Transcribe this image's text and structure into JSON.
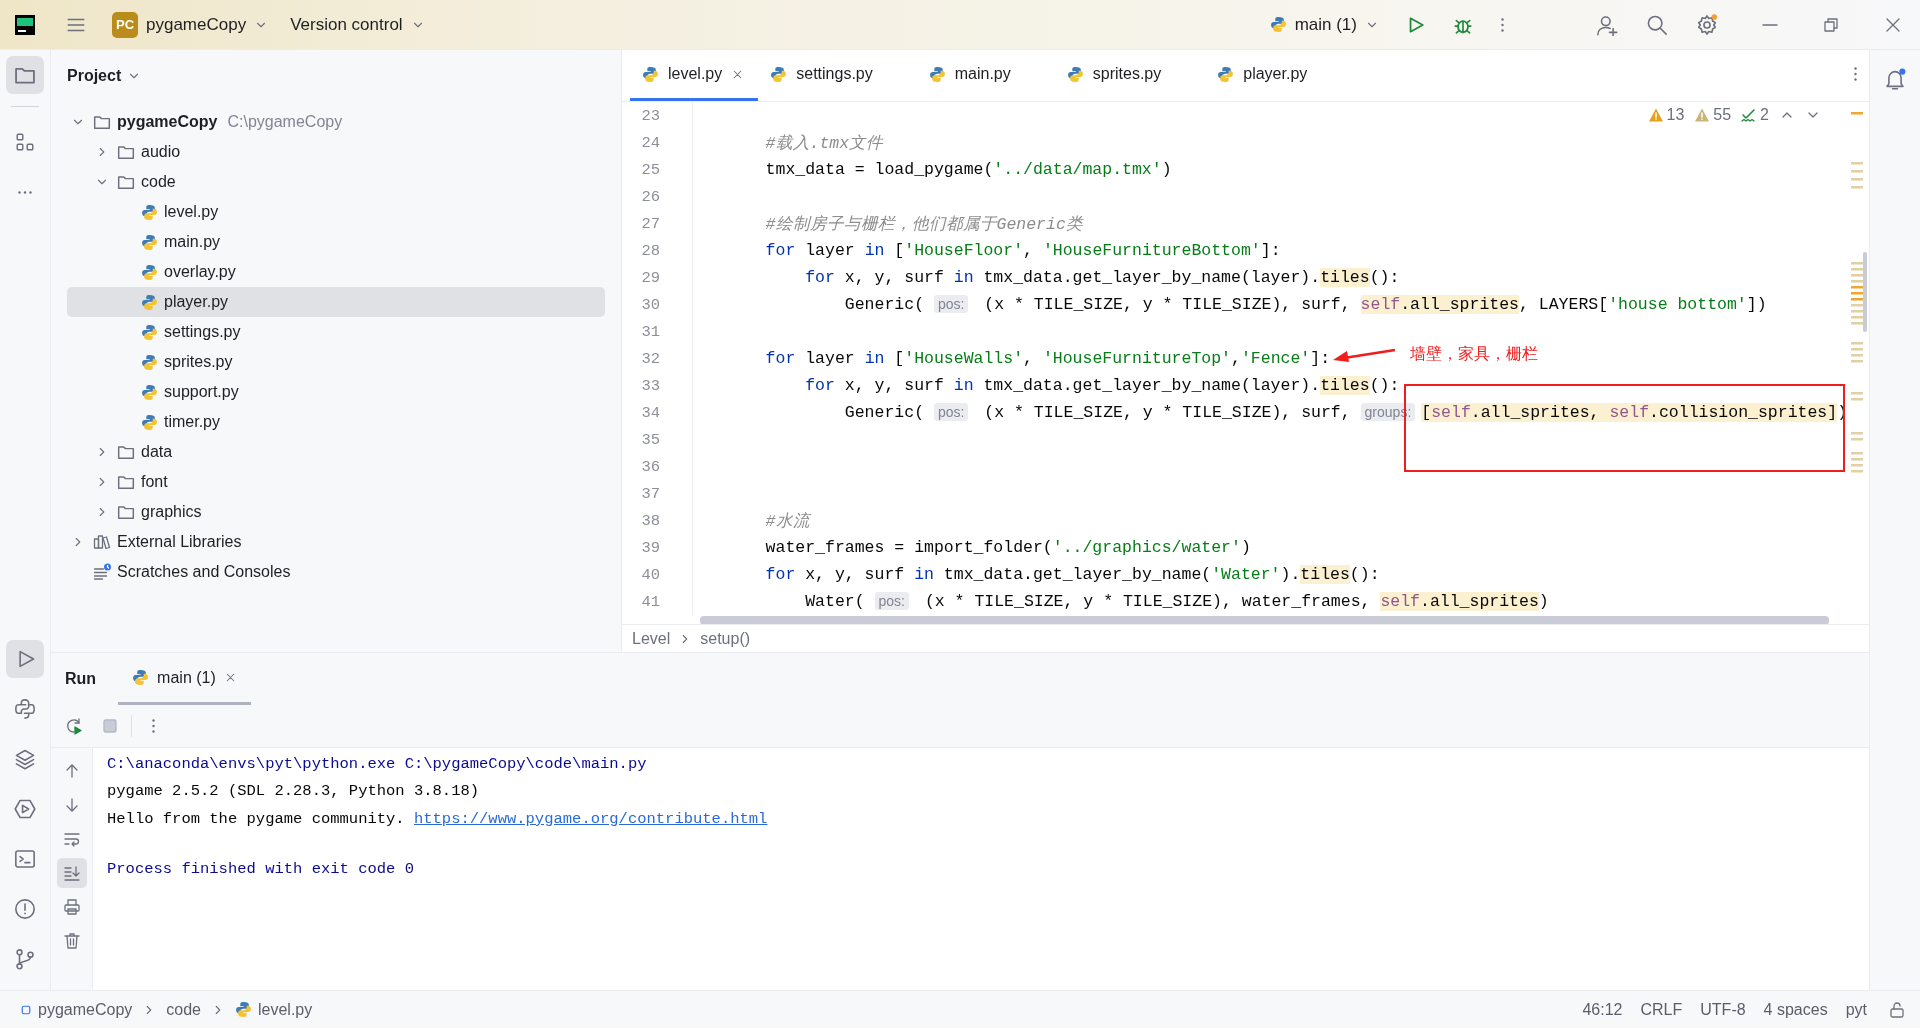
{
  "title_bar": {
    "project_badge": "PC",
    "project": "pygameCopy",
    "vcs": "Version control",
    "run_config": "main (1)"
  },
  "project_panel": {
    "title": "Project",
    "tree": [
      {
        "label": "pygameCopy",
        "path": "C:\\pygameCopy",
        "kind": "folder",
        "expanded": true,
        "selected": false,
        "children": [
          {
            "label": "audio",
            "kind": "folder",
            "expanded": false,
            "selected": false
          },
          {
            "label": "code",
            "kind": "folder",
            "expanded": true,
            "selected": false,
            "children": [
              {
                "label": "level.py",
                "kind": "python",
                "selected": false
              },
              {
                "label": "main.py",
                "kind": "python",
                "selected": false
              },
              {
                "label": "overlay.py",
                "kind": "python",
                "selected": false
              },
              {
                "label": "player.py",
                "kind": "python",
                "selected": true
              },
              {
                "label": "settings.py",
                "kind": "python",
                "selected": false
              },
              {
                "label": "sprites.py",
                "kind": "python",
                "selected": false
              },
              {
                "label": "support.py",
                "kind": "python",
                "selected": false
              },
              {
                "label": "timer.py",
                "kind": "python",
                "selected": false
              }
            ]
          },
          {
            "label": "data",
            "kind": "folder",
            "expanded": false,
            "selected": false
          },
          {
            "label": "font",
            "kind": "folder",
            "expanded": false,
            "selected": false
          },
          {
            "label": "graphics",
            "kind": "folder",
            "expanded": false,
            "selected": false
          }
        ]
      },
      {
        "label": "External Libraries",
        "kind": "library",
        "expanded": false,
        "selected": false
      },
      {
        "label": "Scratches and Consoles",
        "kind": "scratches",
        "selected": false
      }
    ]
  },
  "editor": {
    "tabs": [
      {
        "label": "level.py",
        "selected": true,
        "closable": true
      },
      {
        "label": "settings.py",
        "selected": false,
        "closable": false
      },
      {
        "label": "main.py",
        "selected": false,
        "closable": false
      },
      {
        "label": "sprites.py",
        "selected": false,
        "closable": false
      },
      {
        "label": "player.py",
        "selected": false,
        "closable": false
      }
    ],
    "inspections": [
      {
        "kind": "error",
        "count": "13"
      },
      {
        "kind": "warning",
        "count": "55"
      },
      {
        "kind": "typo",
        "count": "2"
      }
    ],
    "lines": [
      {
        "number": "23"
      },
      {
        "number": "24",
        "tokens": [
          {
            "kind": "comment",
            "text": "    #载入.tmx文件"
          }
        ]
      },
      {
        "number": "25",
        "tokens": [
          {
            "kind": "plain",
            "text": "    tmx_data = load_pygame("
          },
          {
            "kind": "string",
            "text": "'../data/map.tmx'"
          },
          {
            "kind": "plain",
            "text": ")"
          }
        ]
      },
      {
        "number": "26"
      },
      {
        "number": "27",
        "tokens": [
          {
            "kind": "comment",
            "text": "    #绘制房子与栅栏，他们都属于Generic类"
          }
        ]
      },
      {
        "number": "28",
        "tokens": [
          {
            "kind": "keyword",
            "text": "    for"
          },
          {
            "kind": "plain",
            "text": " layer "
          },
          {
            "kind": "keyword",
            "text": "in"
          },
          {
            "kind": "plain",
            "text": " ["
          },
          {
            "kind": "string",
            "text": "'HouseFloor'"
          },
          {
            "kind": "plain",
            "text": ", "
          },
          {
            "kind": "string",
            "text": "'HouseFurnitureBottom'"
          },
          {
            "kind": "plain",
            "text": "]:"
          }
        ]
      },
      {
        "number": "29",
        "tokens": [
          {
            "kind": "keyword",
            "text": "        for"
          },
          {
            "kind": "plain",
            "text": " x, y, surf "
          },
          {
            "kind": "keyword",
            "text": "in"
          },
          {
            "kind": "plain",
            "text": " tmx_data.get_layer_by_name(layer)."
          },
          {
            "kind": "usage",
            "text": "tiles"
          },
          {
            "kind": "plain",
            "text": "():"
          }
        ]
      },
      {
        "number": "30",
        "tokens": [
          {
            "kind": "plain",
            "text": "            Generic( "
          },
          {
            "kind": "inlay",
            "text": "pos:"
          },
          {
            "kind": "plain",
            "text": " (x * TILE_SIZE, y * TILE_SIZE), surf, "
          },
          {
            "kind": "self-usage",
            "text": "self"
          },
          {
            "kind": "usage",
            "text": ".all_sprites"
          },
          {
            "kind": "plain",
            "text": ", LAYERS["
          },
          {
            "kind": "string",
            "text": "'house bottom'"
          },
          {
            "kind": "plain",
            "text": "])"
          }
        ]
      },
      {
        "number": "31"
      },
      {
        "number": "32",
        "tokens": [
          {
            "kind": "keyword",
            "text": "    for"
          },
          {
            "kind": "plain",
            "text": " layer "
          },
          {
            "kind": "keyword",
            "text": "in"
          },
          {
            "kind": "plain",
            "text": " ["
          },
          {
            "kind": "string",
            "text": "'HouseWalls'"
          },
          {
            "kind": "plain",
            "text": ", "
          },
          {
            "kind": "string",
            "text": "'HouseFurnitureTop'"
          },
          {
            "kind": "plain",
            "text": ","
          },
          {
            "kind": "string",
            "text": "'Fence'"
          },
          {
            "kind": "plain",
            "text": "]:"
          }
        ]
      },
      {
        "number": "33",
        "tokens": [
          {
            "kind": "keyword",
            "text": "        for"
          },
          {
            "kind": "plain",
            "text": " x, y, surf "
          },
          {
            "kind": "keyword",
            "text": "in"
          },
          {
            "kind": "plain",
            "text": " tmx_data.get_layer_by_name(layer)."
          },
          {
            "kind": "usage",
            "text": "tiles"
          },
          {
            "kind": "plain",
            "text": "():"
          }
        ]
      },
      {
        "number": "34",
        "tokens": [
          {
            "kind": "plain",
            "text": "            Generic( "
          },
          {
            "kind": "inlay",
            "text": "pos:"
          },
          {
            "kind": "plain",
            "text": " (x * TILE_SIZE, y * TILE_SIZE), surf, "
          },
          {
            "kind": "inlay",
            "text": "groups:"
          },
          {
            "kind": "usage",
            "text": "["
          },
          {
            "kind": "self-usage",
            "text": "self"
          },
          {
            "kind": "usage",
            "text": ".all_sprites, "
          },
          {
            "kind": "self-usage",
            "text": "self"
          },
          {
            "kind": "usage",
            "text": ".collision_sprites]"
          },
          {
            "kind": "plain",
            "text": ")"
          }
        ]
      },
      {
        "number": "35"
      },
      {
        "number": "36"
      },
      {
        "number": "37"
      },
      {
        "number": "38",
        "tokens": [
          {
            "kind": "comment",
            "text": "    #水流"
          }
        ]
      },
      {
        "number": "39",
        "tokens": [
          {
            "kind": "plain",
            "text": "    water_frames = import_folder("
          },
          {
            "kind": "string",
            "text": "'../graphics/water'"
          },
          {
            "kind": "plain",
            "text": ")"
          }
        ]
      },
      {
        "number": "40",
        "tokens": [
          {
            "kind": "keyword",
            "text": "    for"
          },
          {
            "kind": "plain",
            "text": " x, y, surf "
          },
          {
            "kind": "keyword",
            "text": "in"
          },
          {
            "kind": "plain",
            "text": " tmx_data.get_layer_by_name("
          },
          {
            "kind": "string",
            "text": "'Water'"
          },
          {
            "kind": "plain",
            "text": ")."
          },
          {
            "kind": "usage",
            "text": "tiles"
          },
          {
            "kind": "plain",
            "text": "():"
          }
        ]
      },
      {
        "number": "41",
        "tokens": [
          {
            "kind": "plain",
            "text": "        Water( "
          },
          {
            "kind": "inlay",
            "text": "pos:"
          },
          {
            "kind": "plain",
            "text": " (x * TILE_SIZE, y * TILE_SIZE), water_frames, "
          },
          {
            "kind": "self-usage",
            "text": "self"
          },
          {
            "kind": "usage",
            "text": ".all_sprites"
          },
          {
            "kind": "plain",
            "text": ")"
          }
        ]
      }
    ],
    "annotation": {
      "text": "墙壁，家具，栅栏"
    },
    "breadcrumbs": [
      "Level",
      "setup()"
    ]
  },
  "run_panel": {
    "title": "Run",
    "tabs": [
      {
        "label": "main (1)",
        "selected": true
      }
    ],
    "output": [
      {
        "kind": "command",
        "text": "C:\\anaconda\\envs\\pyt\\python.exe C:\\pygameCopy\\code\\main.py"
      },
      {
        "kind": "output",
        "text": "pygame 2.5.2 (SDL 2.28.3, Python 3.8.18)"
      },
      {
        "kind": "output",
        "text": "Hello from the pygame community.",
        "link": "https://www.pygame.org/contribute.html"
      },
      {
        "kind": "exit",
        "text": "Process finished with exit code 0"
      }
    ]
  },
  "status_bar": {
    "breadcrumbs": [
      {
        "kind": "module",
        "label": "pygameCopy"
      },
      {
        "kind": "folder",
        "label": "code"
      },
      {
        "kind": "file",
        "label": "level.py"
      }
    ],
    "items": [
      "46:12",
      "CRLF",
      "UTF-8",
      "4 spaces",
      "pyt"
    ]
  }
}
